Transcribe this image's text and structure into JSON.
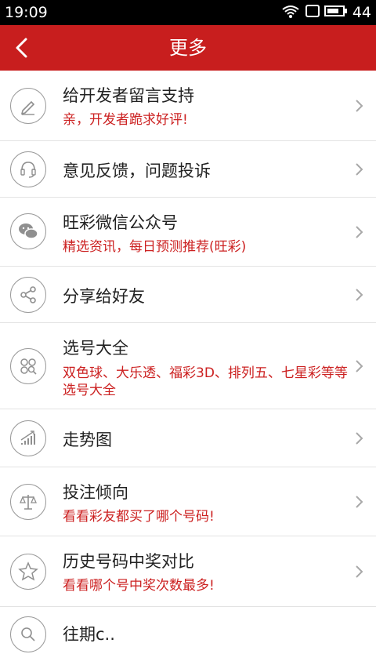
{
  "status": {
    "time": "19:09",
    "level": "44"
  },
  "header": {
    "title": "更多"
  },
  "items": [
    {
      "title": "给开发者留言支持",
      "subtitle": "亲，开发者跪求好评!",
      "icon": "pencil-icon"
    },
    {
      "title": "意见反馈，问题投诉",
      "subtitle": "",
      "icon": "headset-icon"
    },
    {
      "title": "旺彩微信公众号",
      "subtitle": "精选资讯，每日预测推荐(旺彩)",
      "icon": "wechat-icon"
    },
    {
      "title": "分享给好友",
      "subtitle": "",
      "icon": "share-icon"
    },
    {
      "title": "选号大全",
      "subtitle": "双色球、大乐透、福彩3D、排列五、七星彩等等选号大全",
      "icon": "balls-search-icon"
    },
    {
      "title": "走势图",
      "subtitle": "",
      "icon": "trend-chart-icon"
    },
    {
      "title": "投注倾向",
      "subtitle": "看看彩友都买了哪个号码!",
      "icon": "scale-icon"
    },
    {
      "title": "历史号码中奖对比",
      "subtitle": "看看哪个号中奖次数最多!",
      "icon": "star-badge-icon"
    },
    {
      "title": "往期c..",
      "subtitle": "",
      "icon": "search-icon"
    }
  ]
}
